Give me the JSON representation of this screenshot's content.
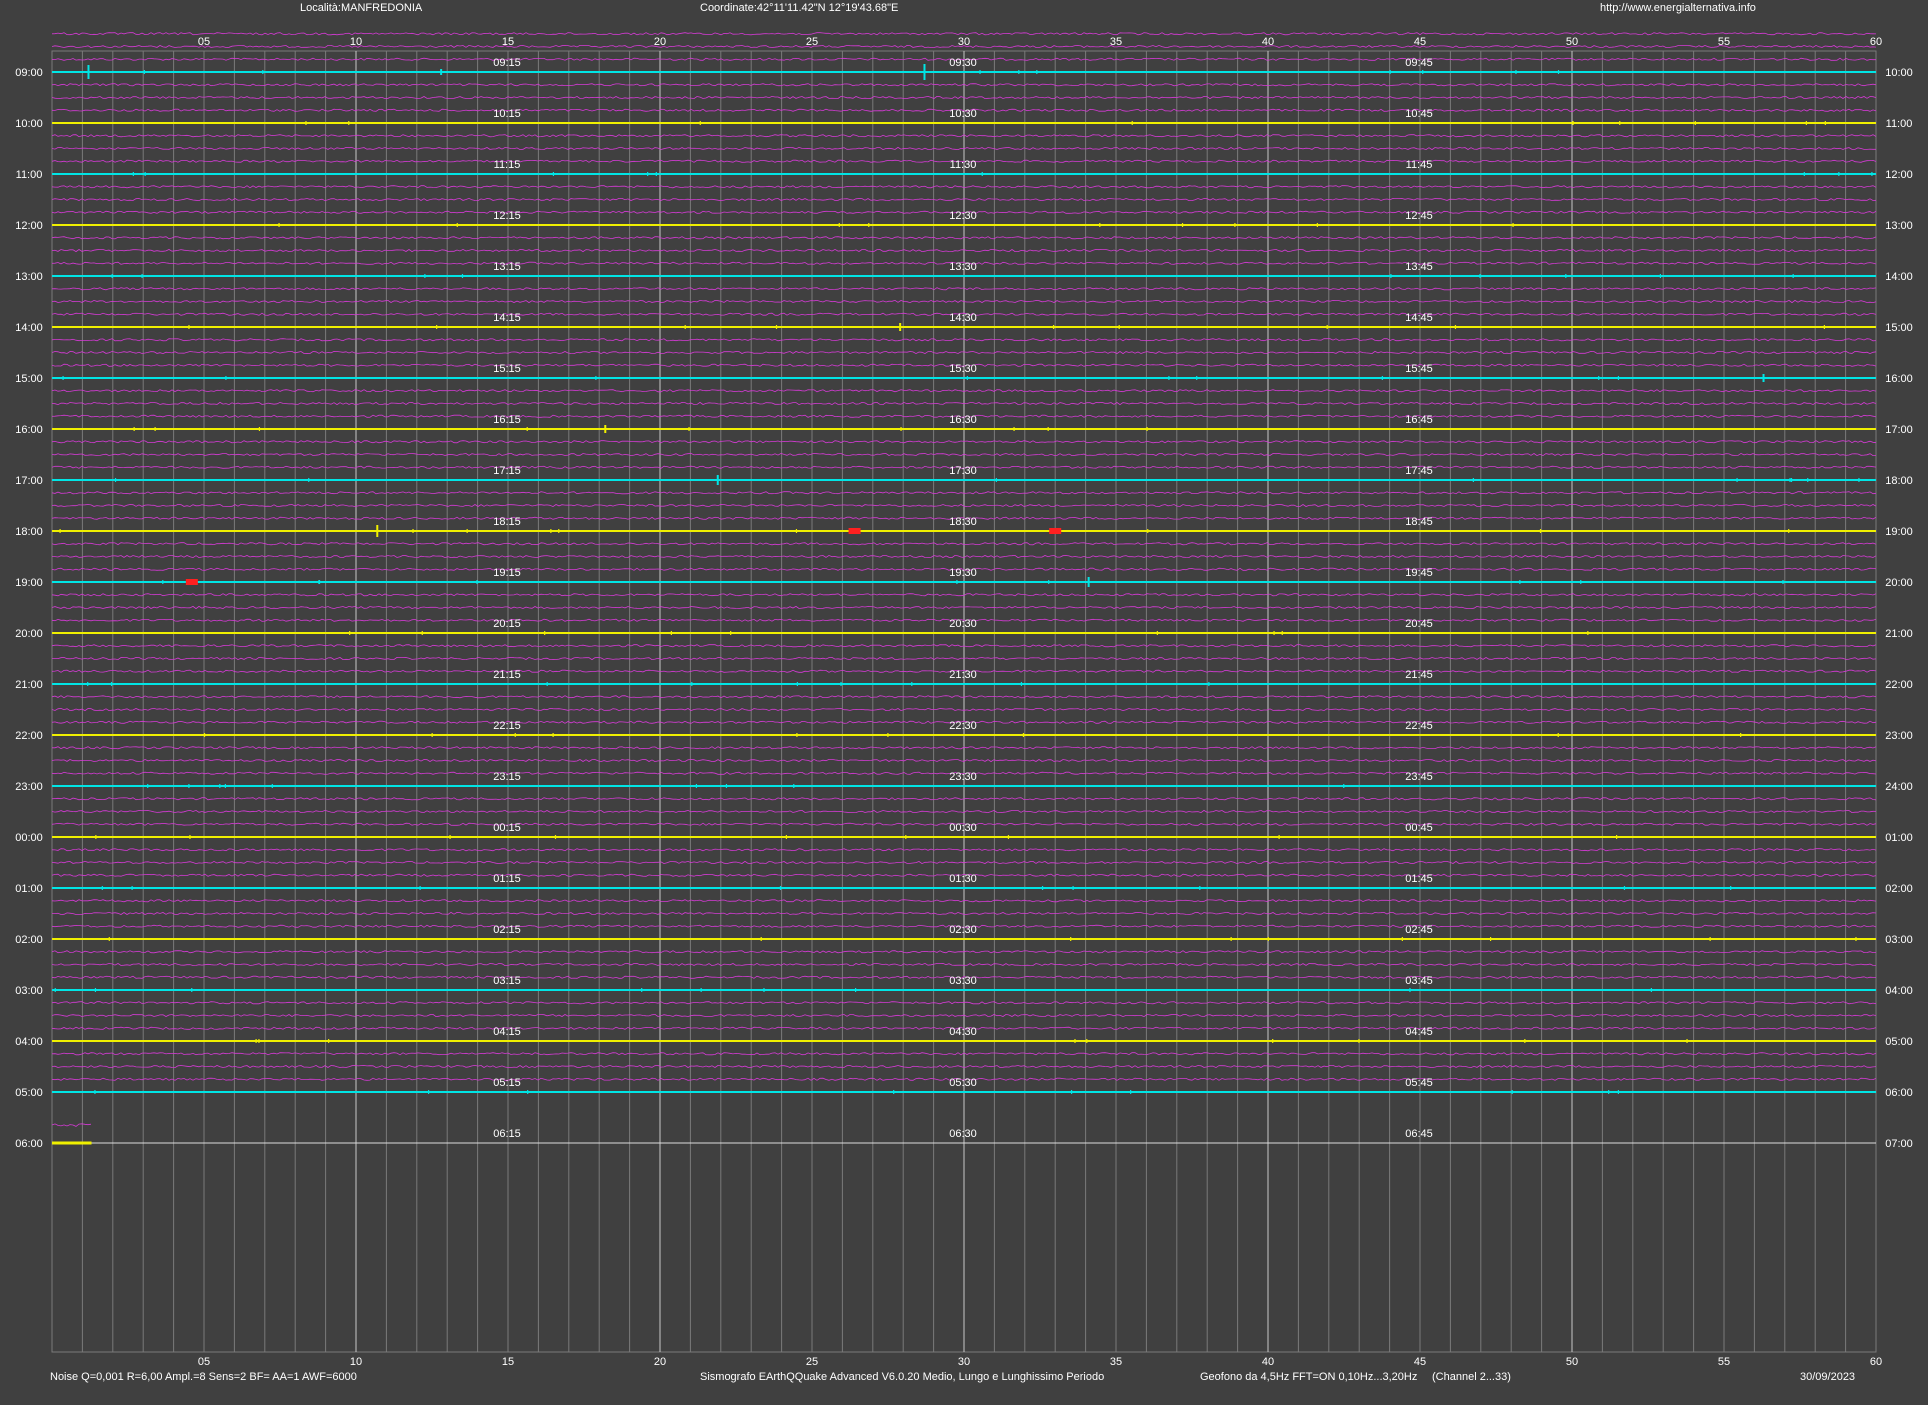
{
  "header": {
    "location": "Località:MANFREDONIA",
    "coordinates": "Coordinate:42°11'11.42\"N  12°19'43.68\"E",
    "website": "http://www.energialternativa.info"
  },
  "footer": {
    "settings": "Noise Q=0,001 R=6,00 Ampl.=8 Sens=2 BF= AA=1 AWF=6000",
    "software": "Sismografo  EArthQQuake Advanced V6.0.20  Medio, Lungo e Lunghissimo Periodo",
    "sensor": "Geofono da 4,5Hz FFT=ON 0,10Hz...3,20Hz",
    "channel": "(Channel 2...33)",
    "date": "30/09/2023"
  },
  "colors": {
    "background": "#404040",
    "grid": "#7a7a7a",
    "grid_major": "#c8c8c8",
    "trace_minor": "#d63ad6",
    "trace_hour_a": "#00e5e5",
    "trace_hour_b": "#f0f000",
    "event": "#ff2020",
    "text": "#ffffff"
  },
  "chart_data": {
    "type": "line",
    "x_ticks": [
      "05",
      "10",
      "15",
      "20",
      "25",
      "30",
      "35",
      "40",
      "45",
      "50",
      "55",
      "60"
    ],
    "xlim": [
      0,
      60
    ],
    "left_hour_labels": [
      "09:00",
      "10:00",
      "11:00",
      "12:00",
      "13:00",
      "14:00",
      "15:00",
      "16:00",
      "17:00",
      "18:00",
      "19:00",
      "20:00",
      "21:00",
      "22:00",
      "23:00",
      "00:00",
      "01:00",
      "02:00",
      "03:00",
      "04:00",
      "05:00",
      "06:00"
    ],
    "right_hour_labels": [
      "10:00",
      "11:00",
      "12:00",
      "13:00",
      "14:00",
      "15:00",
      "16:00",
      "17:00",
      "18:00",
      "19:00",
      "20:00",
      "21:00",
      "22:00",
      "23:00",
      "24:00",
      "01:00",
      "02:00",
      "03:00",
      "04:00",
      "05:00",
      "06:00",
      "07:00"
    ],
    "quarter_labels": [
      [
        "09:15",
        "09:30",
        "09:45"
      ],
      [
        "10:15",
        "10:30",
        "10:45"
      ],
      [
        "11:15",
        "11:30",
        "11:45"
      ],
      [
        "12:15",
        "12:30",
        "12:45"
      ],
      [
        "13:15",
        "13:30",
        "13:45"
      ],
      [
        "14:15",
        "14:30",
        "14:45"
      ],
      [
        "15:15",
        "15:30",
        "15:45"
      ],
      [
        "16:15",
        "16:30",
        "16:45"
      ],
      [
        "17:15",
        "17:30",
        "17:45"
      ],
      [
        "18:15",
        "18:30",
        "18:45"
      ],
      [
        "19:15",
        "19:30",
        "19:45"
      ],
      [
        "20:15",
        "20:30",
        "20:45"
      ],
      [
        "21:15",
        "21:30",
        "21:45"
      ],
      [
        "22:15",
        "22:30",
        "22:45"
      ],
      [
        "23:15",
        "23:30",
        "23:45"
      ],
      [
        "00:15",
        "00:30",
        "00:45"
      ],
      [
        "01:15",
        "01:30",
        "01:45"
      ],
      [
        "02:15",
        "02:30",
        "02:45"
      ],
      [
        "03:15",
        "03:30",
        "03:45"
      ],
      [
        "04:15",
        "04:30",
        "04:45"
      ],
      [
        "05:15",
        "05:30",
        "05:45"
      ],
      [
        "06:15",
        "06:30",
        "06:45"
      ]
    ],
    "quarter_label_minutes": [
      15,
      30,
      45
    ],
    "trace_rows_per_hour": 4,
    "hour_rows_recorded": 21,
    "last_hour_end_minute": 1.3,
    "hour_line_colors": [
      "cyan",
      "yellow"
    ],
    "events": [
      {
        "hour": "09:00",
        "minute": 1.2,
        "color": "cyan",
        "amplitude": 7
      },
      {
        "hour": "09:00",
        "minute": 28.7,
        "color": "cyan",
        "amplitude": 8
      },
      {
        "hour": "09:00",
        "minute": 12.8,
        "color": "cyan",
        "amplitude": 3
      },
      {
        "hour": "14:00",
        "minute": 27.9,
        "color": "yellow",
        "amplitude": 4
      },
      {
        "hour": "15:00",
        "minute": 56.3,
        "color": "cyan",
        "amplitude": 4
      },
      {
        "hour": "16:00",
        "minute": 18.2,
        "color": "yellow",
        "amplitude": 4
      },
      {
        "hour": "17:00",
        "minute": 21.9,
        "color": "cyan",
        "amplitude": 5
      },
      {
        "hour": "18:00",
        "minute": 10.7,
        "color": "yellow",
        "amplitude": 6
      },
      {
        "hour": "18:00",
        "minute": 26.4,
        "color": "red",
        "amplitude": 3
      },
      {
        "hour": "18:00",
        "minute": 33.0,
        "color": "red",
        "amplitude": 3
      },
      {
        "hour": "19:00",
        "minute": 4.6,
        "color": "red",
        "amplitude": 3
      },
      {
        "hour": "19:00",
        "minute": 34.1,
        "color": "cyan",
        "amplitude": 5
      }
    ]
  }
}
